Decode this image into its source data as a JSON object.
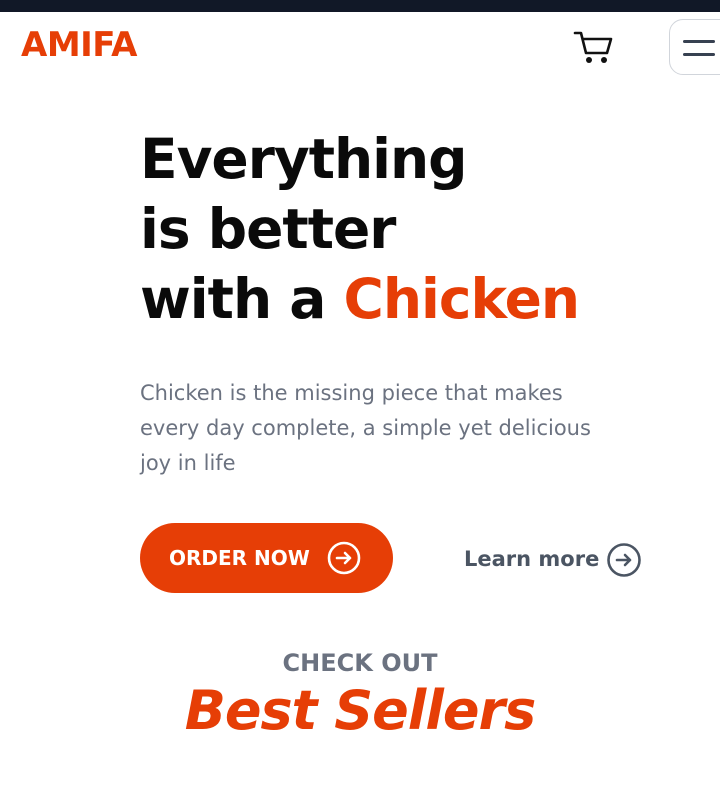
{
  "colors": {
    "accent": "#e63e06",
    "topbar": "#111827",
    "headline": "#0a0a0a",
    "muted": "#6b7280",
    "link": "#4b5563"
  },
  "header": {
    "logo_text": "AMIFA",
    "cart_icon": "shopping-cart-icon",
    "menu_icon": "hamburger-menu-icon"
  },
  "hero": {
    "headline_line1": "Everything",
    "headline_line2": "is better",
    "headline_line3_prefix": "with a ",
    "headline_line3_accent": "Chicken",
    "description": "Chicken is the missing piece that makes every day complete, a simple yet delicious joy in life",
    "order_button_label": "ORDER NOW",
    "order_button_icon": "arrow-right-circle-icon",
    "learn_more_label": "Learn more",
    "learn_more_icon": "arrow-right-circle-icon"
  },
  "best_sellers": {
    "eyebrow": "CHECK OUT",
    "title": "Best Sellers"
  }
}
